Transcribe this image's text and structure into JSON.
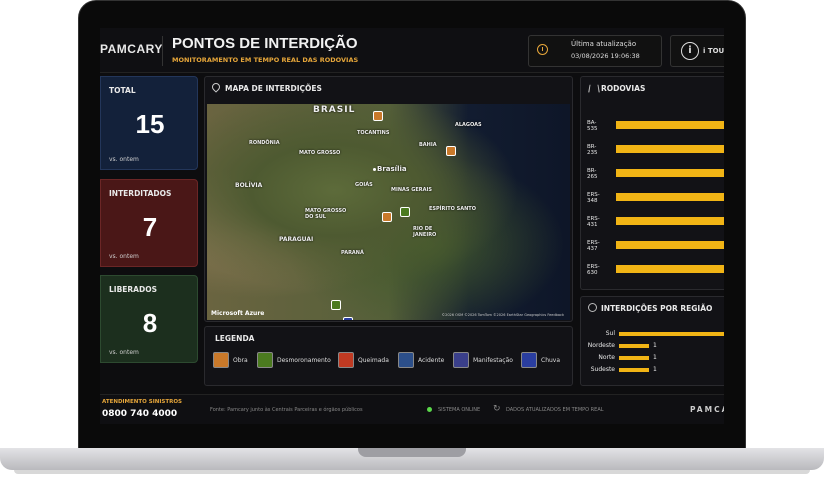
{
  "header": {
    "logo": "PAMCARY",
    "title": "PONTOS DE INTERDIÇÃO",
    "subtitle": "MONITORAMENTO EM TEMPO REAL DAS RODOVIAS",
    "update_label": "Última atualização",
    "update_value": "03/08/2026 19:06:38",
    "info_label": "i TOUR"
  },
  "cards": [
    {
      "label": "TOTAL",
      "value": "15",
      "sub": "vs. ontem",
      "color": "#13213a"
    },
    {
      "label": "INTERDITADOS",
      "value": "7",
      "sub": "vs. ontem",
      "color": "#4a1717"
    },
    {
      "label": "LIBERADOS",
      "value": "8",
      "sub": "vs. ontem",
      "color": "#1c2f1e"
    }
  ],
  "map": {
    "title": "MAPA DE INTERDIÇÕES",
    "labels": [
      "BRASIL",
      "TOCANTINS",
      "ALAGOAS",
      "RONDÔNIA",
      "MATO GROSSO",
      "BAHIA",
      "Brasília",
      "BOLÍVIA",
      "GOIÁS",
      "MINAS GERAIS",
      "MATO GROSSO DO SUL",
      "ESPÍRITO SANTO",
      "PARAGUAI",
      "RIO DE JANEIRO",
      "PARANÁ"
    ],
    "attribution": "©2026 OSM ©2026 TomTom ©2026 EarthStar Geographics Feedback",
    "provider": "Microsoft Azure"
  },
  "legend": {
    "title": "LEGENDA",
    "items": [
      {
        "label": "Obra",
        "color": "#c9792a"
      },
      {
        "label": "Desmoronamento",
        "color": "#4b7a1f"
      },
      {
        "label": "Queimada",
        "color": "#c03a22"
      },
      {
        "label": "Acidente",
        "color": "#2c4f8a"
      },
      {
        "label": "Manifestação",
        "color": "#3a3f8a"
      },
      {
        "label": "Chuva",
        "color": "#2a3ea0"
      }
    ]
  },
  "rodovias": {
    "title": "RODOVIAS",
    "items": [
      "BA-535",
      "BR-235",
      "BR-265",
      "ERS-348",
      "ERS-431",
      "ERS-437",
      "ERS-630"
    ]
  },
  "regioes": {
    "title": "INTERDIÇÕES POR REGIÃO",
    "items": [
      {
        "label": "Sul",
        "value": ""
      },
      {
        "label": "Nordeste",
        "value": "1"
      },
      {
        "label": "Norte",
        "value": "1"
      },
      {
        "label": "Sudeste",
        "value": "1"
      }
    ]
  },
  "footer": {
    "support_label": "ATENDIMENTO SINISTROS",
    "support_phone": "0800 740 4000",
    "source": "Fonte: Pamcary junto às Centrais Parceiras e órgãos públicos",
    "status": "SISTEMA ONLINE",
    "realtime": "DADOS ATUALIZADOS EM TEMPO REAL",
    "brand": "PAMCA"
  }
}
